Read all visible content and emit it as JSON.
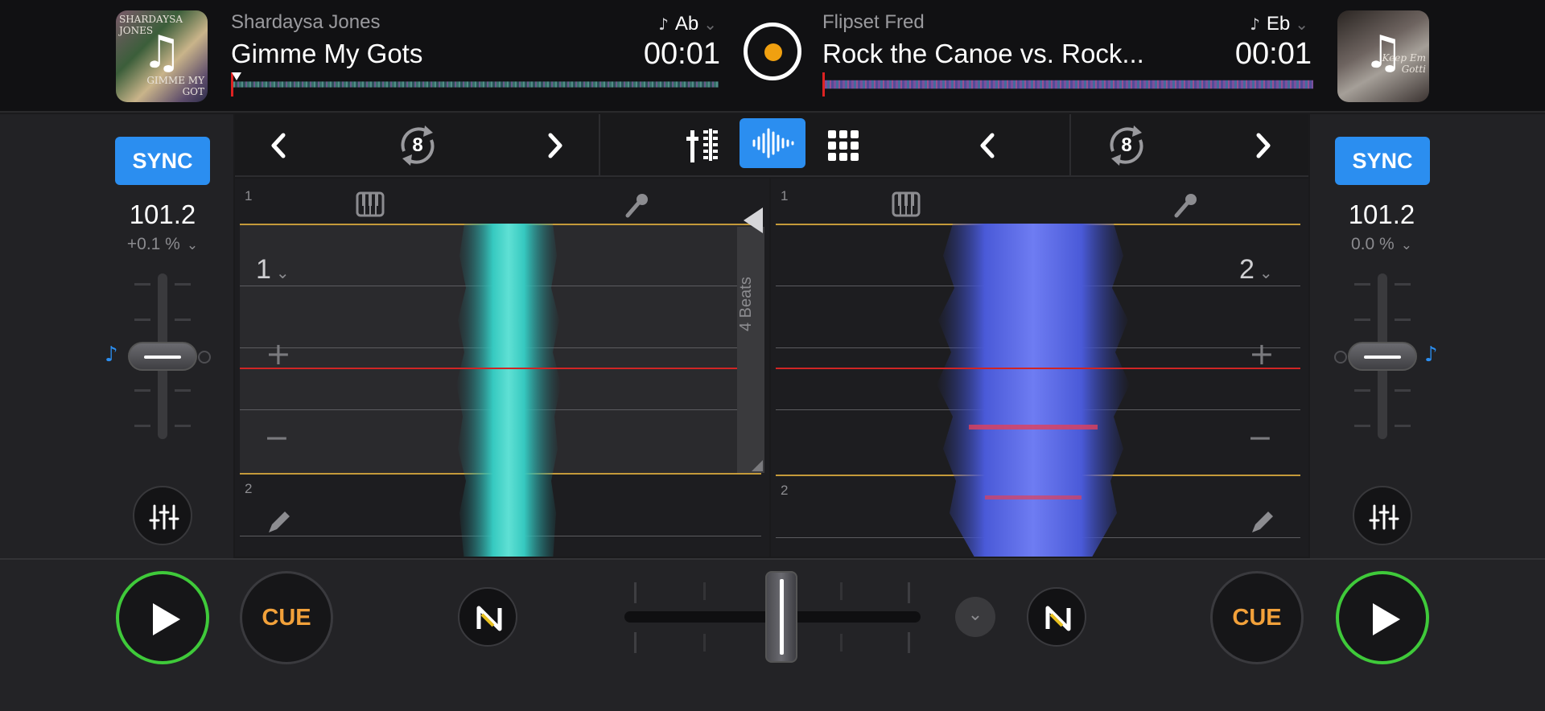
{
  "deck_a": {
    "artist": "Shardaysa Jones",
    "title": "Gimme My Gots",
    "key": "Ab",
    "time": "00:01",
    "cover_text_top": "SHARDAYSA JONES",
    "cover_text_bottom": "GIMME MY GOT",
    "sync_label": "SYNC",
    "bpm": "101.2",
    "pitch": "+0.1 %",
    "loop_size": "8",
    "beat_top": "1",
    "beat_bottom": "2",
    "cue_bank": "1",
    "beats_label": "4 Beats",
    "cue_label": "CUE"
  },
  "deck_b": {
    "artist": "Flipset Fred",
    "title": "Rock the Canoe vs. Rock...",
    "key": "Eb",
    "time": "00:01",
    "cover_text": "Keep Em Gotti",
    "sync_label": "SYNC",
    "bpm": "101.2",
    "pitch": "0.0 %",
    "loop_size": "8",
    "beat_top": "1",
    "beat_bottom": "2",
    "cue_bank": "2",
    "cue_label": "CUE"
  },
  "colors": {
    "accent_blue": "#2b8ef0",
    "play_green": "#3fca3a",
    "cue_orange": "#f2a13a",
    "wave_a": "#36c9c0",
    "wave_b": "#5a6cf0"
  },
  "icons": {
    "center": "platter-disc-icon",
    "mixer": "mixer-icon",
    "waveform": "waveform-icon",
    "pads": "pads-grid-icon",
    "loop": "loop-icon",
    "eq": "eq-sliders-icon",
    "neural_mix": "neural-mix-icon"
  }
}
